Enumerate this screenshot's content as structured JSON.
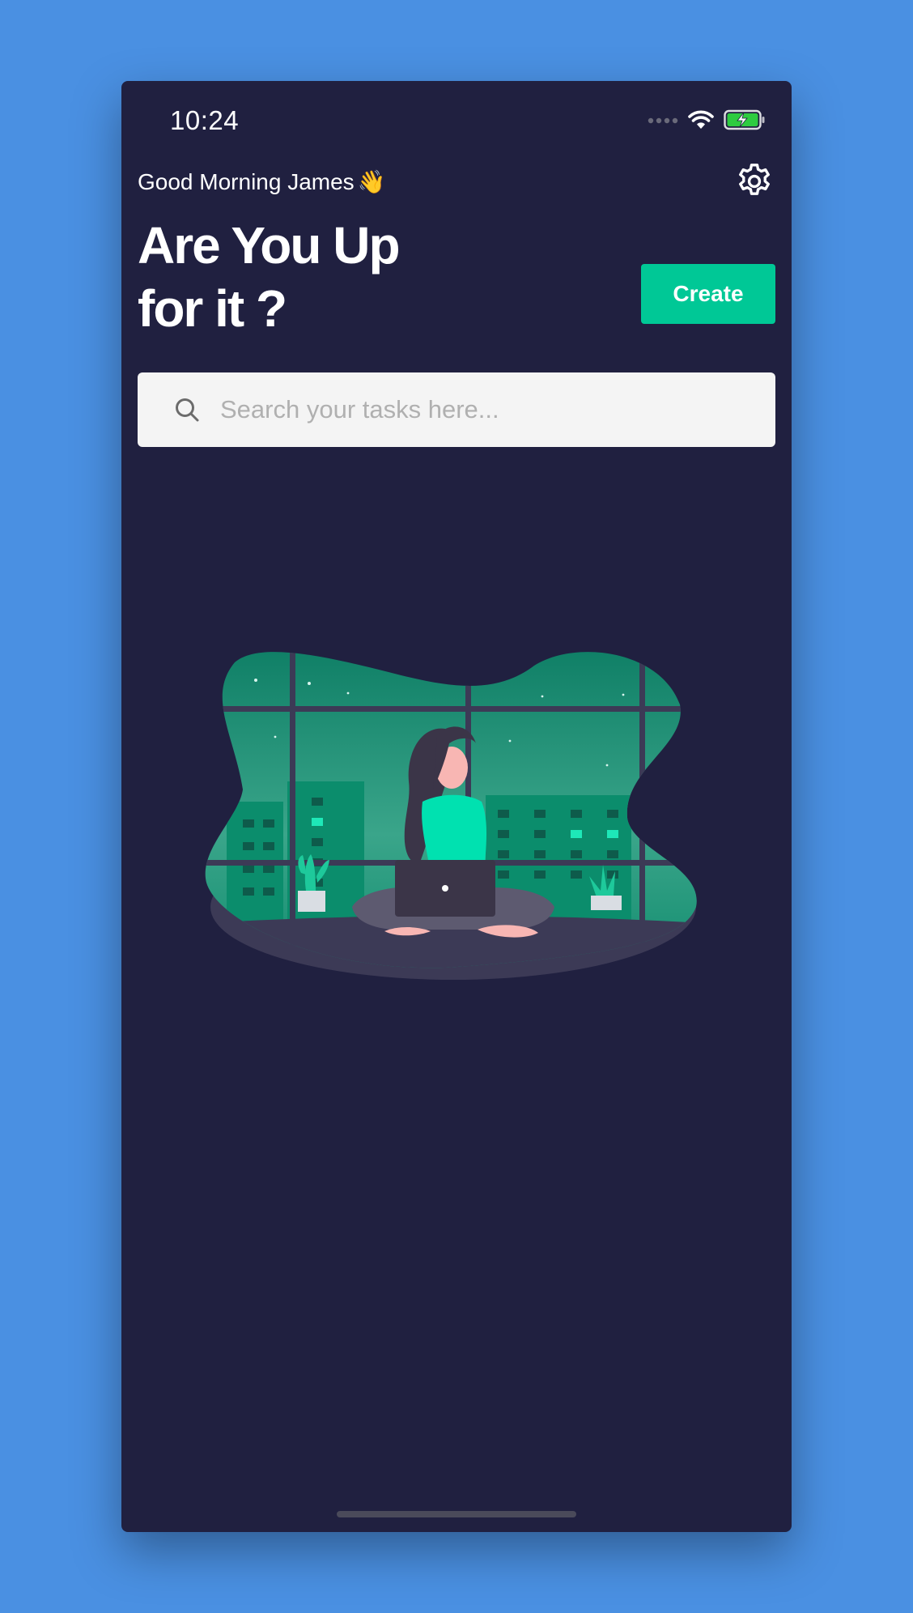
{
  "status_bar": {
    "time": "10:24",
    "signal_icon": "signal-dots-icon",
    "wifi_icon": "wifi-icon",
    "battery_icon": "battery-charging-icon",
    "battery_color": "#2ecc40"
  },
  "header": {
    "greeting": "Good Morning James",
    "greeting_emoji": "👋",
    "settings_icon": "gear-icon",
    "headline_line1": "Are You Up",
    "headline_line2": "for it ?",
    "create_label": "Create"
  },
  "search": {
    "placeholder": "Search your tasks here...",
    "value": "",
    "icon": "search-icon"
  },
  "empty_state": {
    "illustration": "woman-with-laptop-illustration"
  },
  "colors": {
    "background": "#202040",
    "accent": "#00c896",
    "page_bg": "#4a90e2"
  }
}
